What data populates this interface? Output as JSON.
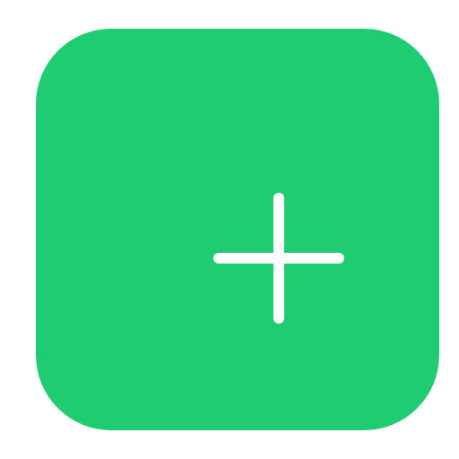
{
  "app_icon": {
    "name": "add",
    "icon": "plus-icon",
    "background_color": "#20cc72",
    "icon_color": "#ffffff"
  }
}
